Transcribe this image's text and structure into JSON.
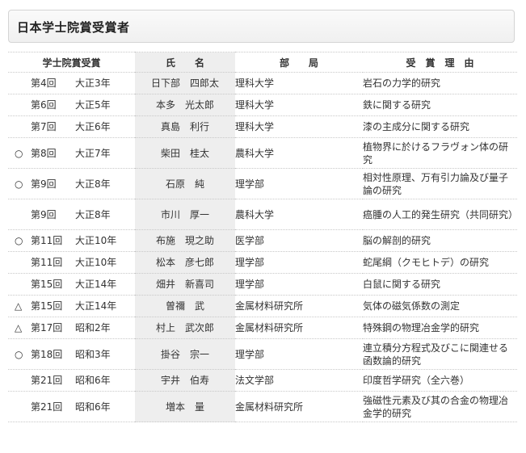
{
  "page": {
    "title": "日本学士院賞受賞者"
  },
  "table": {
    "headers": {
      "award": "学士院賞受賞",
      "name": "氏　　名",
      "dept": "部　　局",
      "reason": "受　賞　理　由"
    },
    "rows": [
      {
        "mark": "",
        "round": "第4回",
        "era": "大正3年",
        "name": "日下部　四郎太",
        "dept": "理科大学",
        "reason": "岩石の力学的研究"
      },
      {
        "mark": "",
        "round": "第6回",
        "era": "大正5年",
        "name": "本多　光太郎",
        "dept": "理科大学",
        "reason": "鉄に関する研究"
      },
      {
        "mark": "",
        "round": "第7回",
        "era": "大正6年",
        "name": "真島　利行",
        "dept": "理科大学",
        "reason": "漆の主成分に関する研究"
      },
      {
        "mark": "○",
        "round": "第8回",
        "era": "大正7年",
        "name": "柴田　桂太",
        "dept": "農科大学",
        "reason": "植物界に於けるフラヴォン体の研究"
      },
      {
        "mark": "○",
        "round": "第9回",
        "era": "大正8年",
        "name": "石原　純",
        "dept": "理学部",
        "reason": "相対性原理、万有引力論及び量子論の研究"
      },
      {
        "mark": "",
        "round": "第9回",
        "era": "大正8年",
        "name": "市川　厚一",
        "dept": "農科大学",
        "reason": "癌腫の人工的発生研究（共同研究）"
      },
      {
        "mark": "○",
        "round": "第11回",
        "era": "大正10年",
        "name": "布施　現之助",
        "dept": "医学部",
        "reason": "脳の解剖的研究"
      },
      {
        "mark": "",
        "round": "第11回",
        "era": "大正10年",
        "name": "松本　彦七郎",
        "dept": "理学部",
        "reason": "蛇尾綱（クモヒトデ）の研究"
      },
      {
        "mark": "",
        "round": "第15回",
        "era": "大正14年",
        "name": "畑井　新喜司",
        "dept": "理学部",
        "reason": "白鼠に関する研究"
      },
      {
        "mark": "△",
        "round": "第15回",
        "era": "大正14年",
        "name": "曽禰　武",
        "dept": "金属材料研究所",
        "reason": "気体の磁気係数の測定"
      },
      {
        "mark": "△",
        "round": "第17回",
        "era": "昭和2年",
        "name": "村上　武次郎",
        "dept": "金属材料研究所",
        "reason": "特殊鋼の物理冶金学的研究"
      },
      {
        "mark": "○",
        "round": "第18回",
        "era": "昭和3年",
        "name": "掛谷　宗一",
        "dept": "理学部",
        "reason": "連立積分方程式及びこに関連せる函数論的研究"
      },
      {
        "mark": "",
        "round": "第21回",
        "era": "昭和6年",
        "name": "宇井　伯寿",
        "dept": "法文学部",
        "reason": "印度哲学研究（全六巻）"
      },
      {
        "mark": "",
        "round": "第21回",
        "era": "昭和6年",
        "name": "増本　量",
        "dept": "金属材料研究所",
        "reason": "強磁性元素及び其の合金の物理冶金学的研究"
      }
    ]
  }
}
